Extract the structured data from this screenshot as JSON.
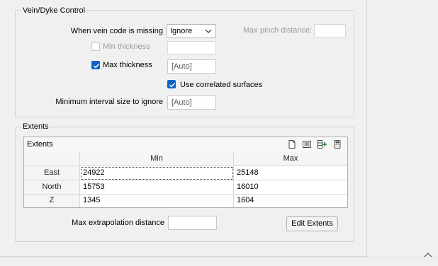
{
  "vein_group": {
    "title": "Vein/Dyke Control",
    "missing_label": "When vein code is missing",
    "missing_value": "Ignore",
    "max_pinch_label": "Max pinch distance:",
    "max_pinch_value": "",
    "min_thickness_label": "Min thickness",
    "min_thickness_checked": false,
    "min_thickness_value": "",
    "max_thickness_label": "Max thickness",
    "max_thickness_checked": true,
    "max_thickness_value": "[Auto]",
    "correlated_label": "Use correlated surfaces",
    "correlated_checked": true,
    "min_interval_label": "Minimum interval size to ignore",
    "min_interval_value": "[Auto]"
  },
  "extents_group": {
    "title": "Extents",
    "grid_title": "Extents",
    "columns": [
      "Min",
      "Max"
    ],
    "rows": [
      {
        "label": "East",
        "min": "24922",
        "max": "25148"
      },
      {
        "label": "North",
        "min": "15753",
        "max": "16010"
      },
      {
        "label": "Z",
        "min": "1345",
        "max": "1604"
      }
    ],
    "toolbar_icons": [
      "new-file-icon",
      "form-icon",
      "insert-column-icon",
      "calculator-icon"
    ],
    "max_extrapolation_label": "Max extrapolation distance",
    "max_extrapolation_value": "",
    "edit_extents_label": "Edit Extents"
  },
  "colors": {
    "accent": "#0a64c6",
    "background": "#f0f0f0"
  }
}
